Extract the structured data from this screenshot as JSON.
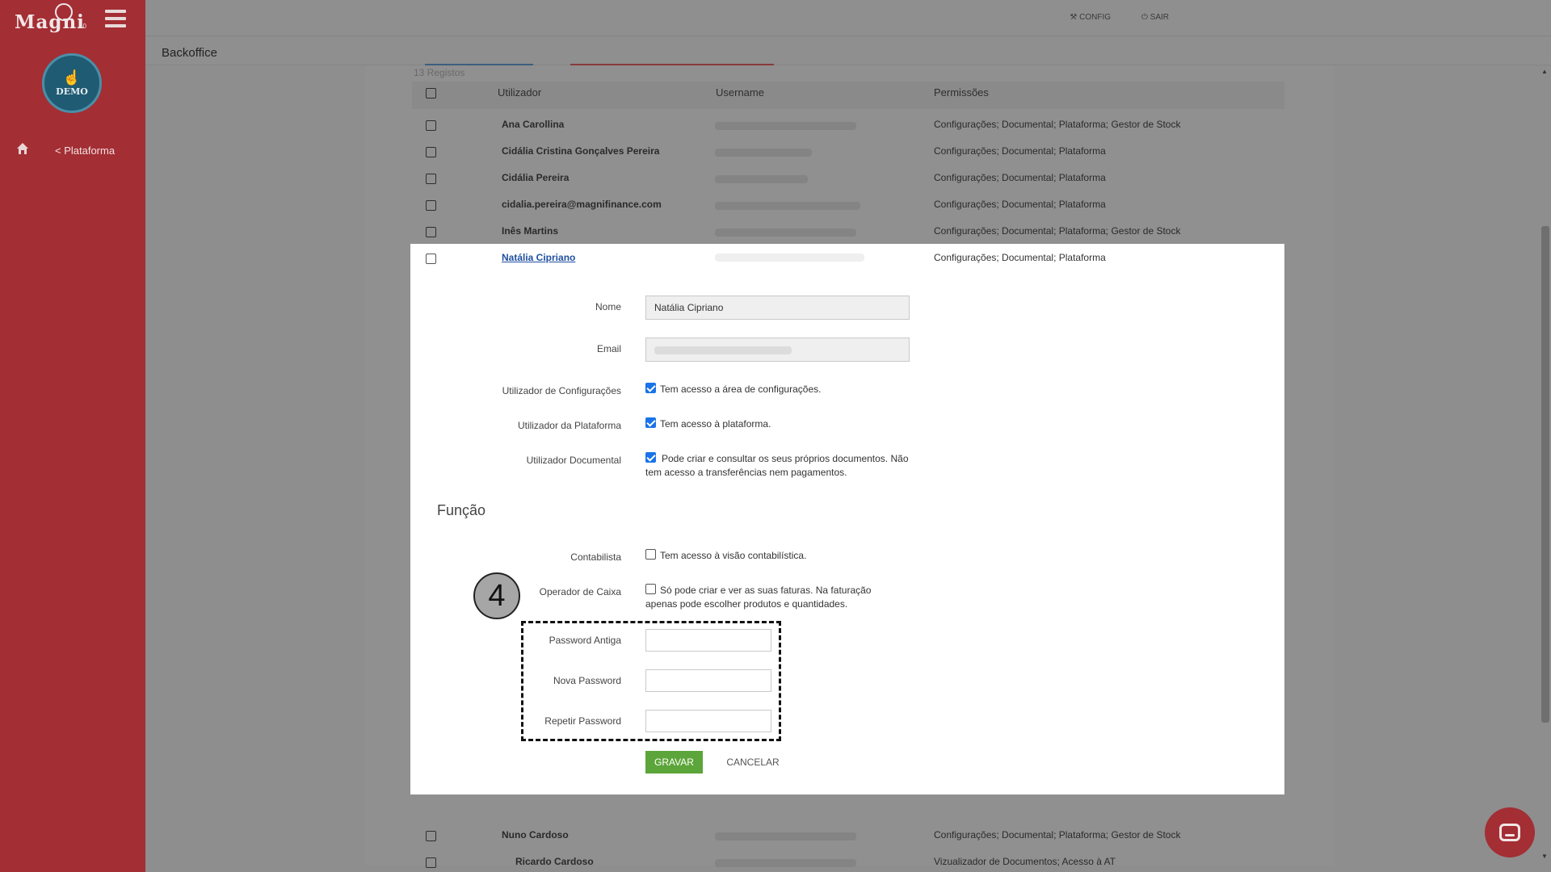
{
  "app": {
    "logo_text": "Magni",
    "logo_version": "10",
    "avatar_label": "DEMO",
    "nav_platform": "< Plataforma"
  },
  "topbar": {
    "config_label": "CONFIG",
    "sair_label": "SAIR",
    "config_icon": "wrench-icon",
    "sair_icon": "power-icon"
  },
  "page": {
    "title": "Backoffice",
    "records_count": "13 Registos"
  },
  "table": {
    "headers": [
      "Utilizador",
      "Username",
      "Permissões"
    ],
    "rows": [
      {
        "name": "Ana Carollina",
        "perm": "Configurações; Documental; Plataforma; Gestor de Stock"
      },
      {
        "name": "Cidália Cristina Gonçalves Pereira",
        "perm": "Configurações; Documental; Plataforma"
      },
      {
        "name": "Cidália Pereira",
        "perm": "Configurações; Documental; Plataforma"
      },
      {
        "name": "cidalia.pereira@magnifinance.com",
        "perm": "Configurações; Documental; Plataforma"
      },
      {
        "name": "Inês Martins",
        "perm": "Configurações; Documental; Plataforma; Gestor de Stock"
      },
      {
        "name": "Natália Cipriano",
        "perm": "Configurações; Documental; Plataforma"
      },
      {
        "name": "Nuno Cardoso",
        "perm": "Configurações; Documental; Plataforma; Gestor de Stock"
      },
      {
        "name": "Ricardo Cardoso",
        "perm": "Vizualizador de Documentos; Acesso à AT"
      }
    ]
  },
  "modal": {
    "nome_label": "Nome",
    "nome_value": "Natália Cipriano",
    "email_label": "Email",
    "config_label": "Utilizador de Configurações",
    "config_desc": "Tem acesso a área de configurações.",
    "config_checked": true,
    "plataforma_label": "Utilizador da Plataforma",
    "plataforma_desc": "Tem acesso à plataforma.",
    "plataforma_checked": true,
    "documental_label": "Utilizador Documental",
    "documental_desc": "Pode criar e consultar os seus próprios documentos. Não tem acesso a transferências nem pagamentos.",
    "documental_checked": true,
    "funcao_heading": "Função",
    "contabilista_label": "Contabilista",
    "contabilista_desc": "Tem acesso à visão contabilística.",
    "contabilista_checked": false,
    "caixa_label": "Operador de Caixa",
    "caixa_desc": "Só pode criar e ver as suas faturas. Na faturação apenas pode escolher produtos e quantidades.",
    "caixa_checked": false,
    "pw_old_label": "Password Antiga",
    "pw_new_label": "Nova Password",
    "pw_repeat_label": "Repetir Password",
    "pw_old_value": "",
    "pw_new_value": "",
    "pw_repeat_value": "",
    "save_label": "GRAVAR",
    "cancel_label": "CANCELAR",
    "step_number": "4"
  },
  "colors": {
    "sidebar": "#a32e34",
    "save_button": "#5ca53a",
    "checkbox_on": "#1a73e8",
    "link": "#1f4fa0"
  }
}
